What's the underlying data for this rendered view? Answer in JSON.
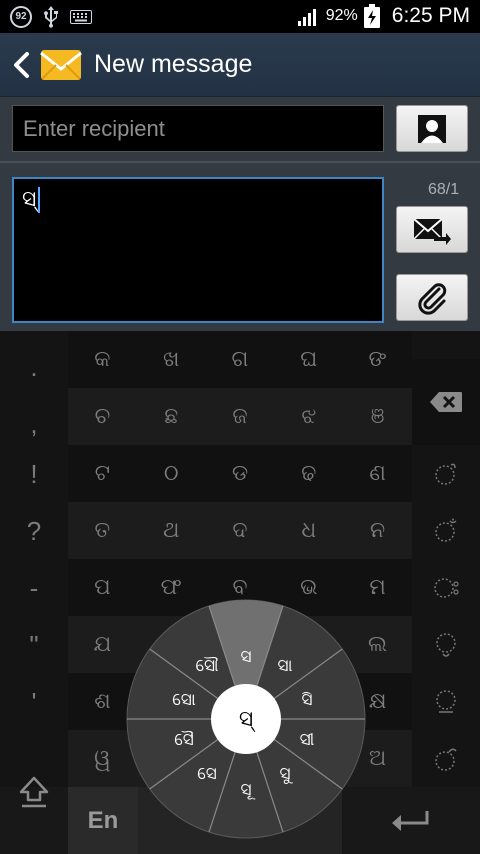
{
  "status_bar": {
    "notification_count": "92",
    "battery_percent": "92%",
    "time": "6:25 PM"
  },
  "header": {
    "title": "New message"
  },
  "compose": {
    "recipient_placeholder": "Enter recipient",
    "message_text": "ସ୍",
    "char_count": "68/1"
  },
  "keyboard": {
    "punctuation": [
      ".",
      ",",
      "!",
      "?",
      "-",
      "\"",
      "'"
    ],
    "rows": [
      [
        "କ",
        "ଖ",
        "ଗ",
        "ଘ",
        "ଙ"
      ],
      [
        "ଚ",
        "ଛ",
        "ଜ",
        "ଝ",
        "ଞ"
      ],
      [
        "ଟ",
        "ଠ",
        "ଡ",
        "ଢ",
        "ଣ"
      ],
      [
        "ତ",
        "ଥ",
        "ଦ",
        "ଧ",
        "ନ"
      ],
      [
        "ପ",
        "ଫ",
        "ବ",
        "ଭ",
        "ମ"
      ],
      [
        "ଯ",
        "",
        "",
        "",
        "ଲ"
      ],
      [
        "ଶ",
        "",
        "",
        "",
        "କ୍ଷ"
      ],
      [
        "ୱ",
        "",
        "",
        "",
        "ଅ"
      ]
    ],
    "lang_key": "En",
    "radial": {
      "center": "ସ୍",
      "options": {
        "top": "ସ",
        "top_right": "ସା",
        "right_upper": "ସି",
        "right_lower": "ସୀ",
        "bottom_right": "ସୁ",
        "bottom": "ସୂ",
        "bottom_left": "ସେ",
        "left_lower": "ସୈ",
        "left_upper": "ସୋ",
        "top_left": "ସୌ"
      }
    }
  }
}
